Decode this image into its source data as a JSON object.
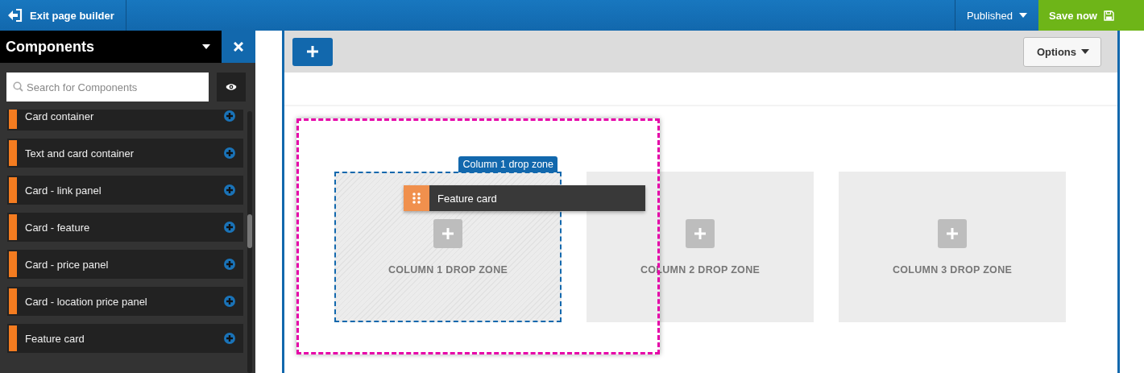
{
  "topbar": {
    "exit_label": "Exit page builder",
    "status": "Published",
    "save_label": "Save now"
  },
  "sidebar": {
    "title": "Components",
    "search": {
      "placeholder": "Search for Components"
    },
    "items": [
      {
        "label": "Card container"
      },
      {
        "label": "Text and card container"
      },
      {
        "label": "Card - link panel"
      },
      {
        "label": "Card - feature"
      },
      {
        "label": "Card - price panel"
      },
      {
        "label": "Card - location price panel"
      },
      {
        "label": "Feature card"
      }
    ]
  },
  "canvas": {
    "options_label": "Options",
    "columns": [
      {
        "label": "COLUMN 1 DROP ZONE",
        "highlighted": true,
        "tag": "Column 1 drop zone"
      },
      {
        "label": "COLUMN 2 DROP ZONE",
        "highlighted": false
      },
      {
        "label": "COLUMN 3 DROP ZONE",
        "highlighted": false
      }
    ],
    "dragged_item": {
      "label": "Feature card"
    }
  }
}
